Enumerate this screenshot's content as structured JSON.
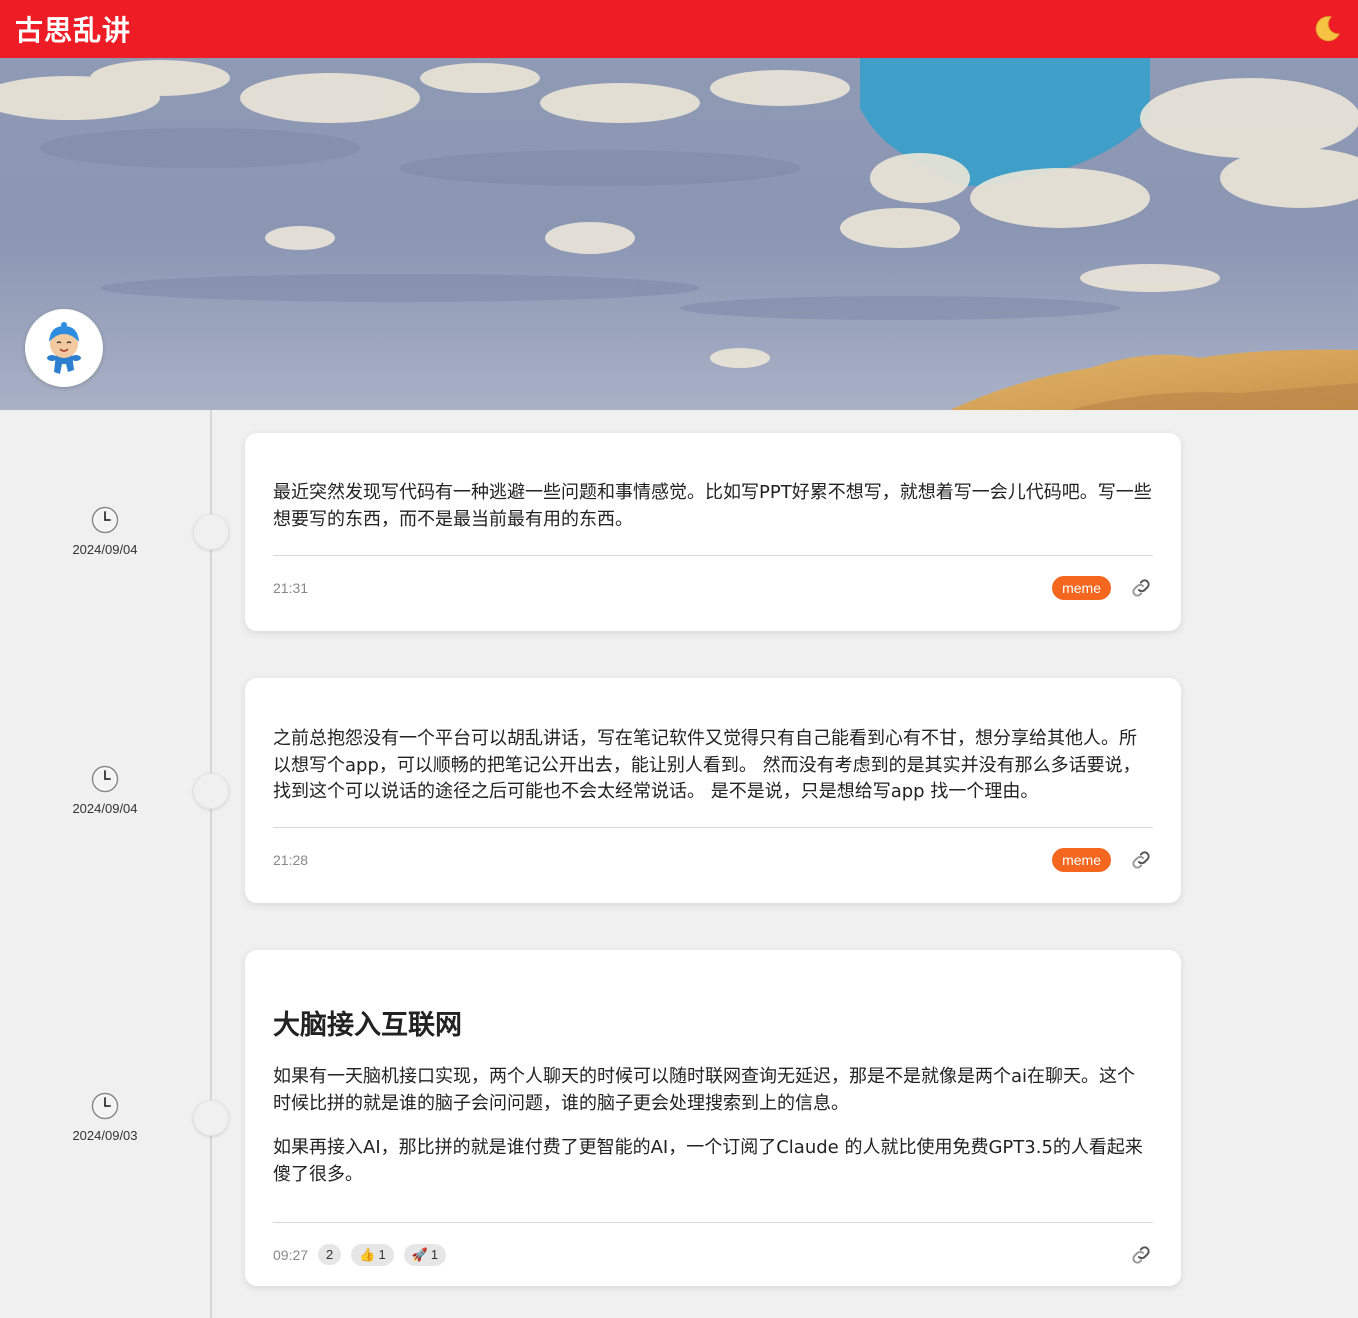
{
  "header": {
    "title": "古思乱讲",
    "theme_icon": "moon-icon"
  },
  "posts": [
    {
      "date": "2024/09/04",
      "heading": "",
      "paragraphs": [
        "最近突然发现写代码有一种逃避一些问题和事情感觉。比如写PPT好累不想写，就想着写一会儿代码吧。写一些想要写的东西，而不是最当前最有用的东西。"
      ],
      "time": "21:31",
      "tag": "meme"
    },
    {
      "date": "2024/09/04",
      "heading": "",
      "paragraphs": [
        "之前总抱怨没有一个平台可以胡乱讲话，写在笔记软件又觉得只有自己能看到心有不甘，想分享给其他人。所以想写个app，可以顺畅的把笔记公开出去，能让别人看到。 然而没有考虑到的是其实并没有那么多话要说，找到这个可以说话的途径之后可能也不会太经常说话。 是不是说，只是想给写app 找一个理由。"
      ],
      "time": "21:28",
      "tag": "meme"
    },
    {
      "date": "2024/09/03",
      "heading": "大脑接入互联网",
      "paragraphs": [
        "如果有一天脑机接口实现，两个人聊天的时候可以随时联网查询无延迟，那是不是就像是两个ai在聊天。这个时候比拼的就是谁的脑子会问问题，谁的脑子更会处理搜索到上的信息。",
        "如果再接入AI，那比拼的就是谁付费了更智能的AI，一个订阅了Claude 的人就比使用免费GPT3.5的人看起来傻了很多。"
      ],
      "time": "09:27",
      "comment_count": "2",
      "reactions": [
        {
          "emoji": "👍",
          "count": "1"
        },
        {
          "emoji": "🚀",
          "count": "1"
        }
      ]
    }
  ]
}
